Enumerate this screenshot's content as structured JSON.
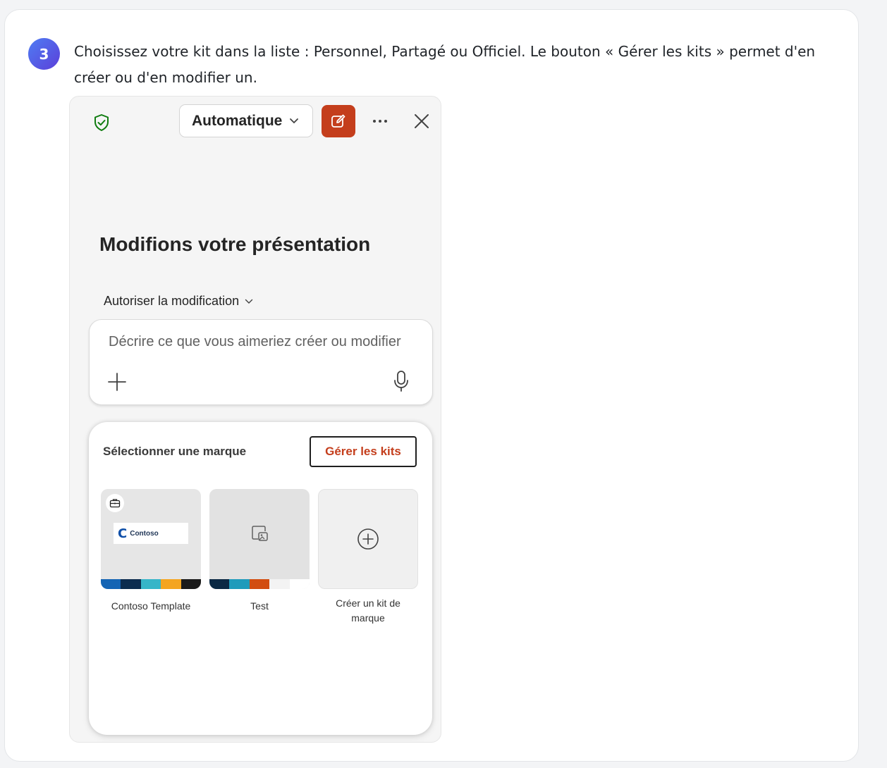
{
  "step": {
    "number": "3",
    "text": "Choisissez votre kit dans la liste : Personnel, Partagé ou Officiel. Le bouton « Gérer les kits » permet d'en créer ou d'en modifier un."
  },
  "panel": {
    "header": {
      "mode_label": "Automatique",
      "icons": [
        "shield-check-icon",
        "chevron-down-icon",
        "compose-icon",
        "more-icon",
        "close-icon"
      ],
      "accent_color": "#c43e1c"
    },
    "heading": "Modifions votre présentation",
    "allow_edit_label": "Autoriser la modification",
    "prompt": {
      "placeholder": "Décrire ce que vous aimeriez créer ou modifier",
      "icons": [
        "plus-icon",
        "microphone-icon"
      ]
    },
    "brand_sheet": {
      "title": "Sélectionner une marque",
      "manage_button": "Gérer les kits",
      "kits": [
        {
          "label": "Contoso Template",
          "logo_text": "Contoso",
          "icon": "briefcase-icon",
          "swatches": [
            "#1464b4",
            "#0c2d4f",
            "#36b5c8",
            "#f4a521",
            "#1b1b1b"
          ]
        },
        {
          "label": "Test",
          "icon": "image-placeholder-icon",
          "swatches": [
            "#0b2944",
            "#1f9bbb",
            "#d24d10",
            "#f3f3f3",
            "#ffffff"
          ]
        },
        {
          "label": "Créer un kit de marque",
          "icon": "add-circle-icon"
        }
      ]
    }
  }
}
